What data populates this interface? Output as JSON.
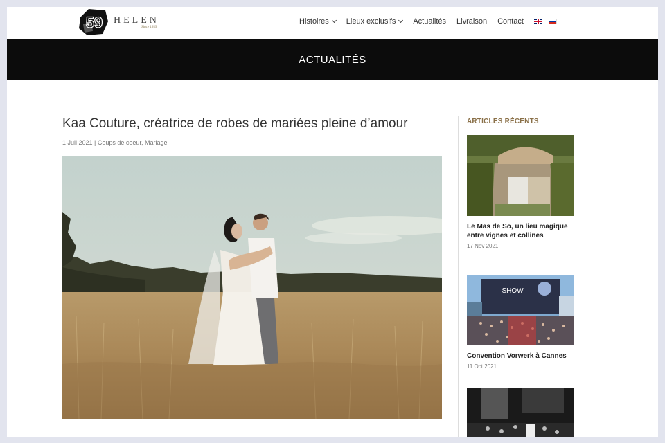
{
  "header": {
    "logo": {
      "number": "59",
      "name": "HELEN",
      "since": "Since 1959"
    },
    "nav": [
      {
        "label": "Histoires",
        "dropdown": true
      },
      {
        "label": "Lieux exclusifs",
        "dropdown": true
      },
      {
        "label": "Actualités",
        "dropdown": false
      },
      {
        "label": "Livraison",
        "dropdown": false
      },
      {
        "label": "Contact",
        "dropdown": false
      }
    ],
    "flags": [
      "english-flag-icon",
      "russian-flag-icon"
    ]
  },
  "banner": {
    "title": "ACTUALITÉS"
  },
  "article": {
    "title": "Kaa Couture, créatrice de robes de mariées pleine d’amour",
    "date": "1 Juil 2021",
    "separator": " | ",
    "category_1": "Coups de coeur",
    "category_sep": ", ",
    "category_2": "Mariage"
  },
  "sidebar": {
    "title": "ARTICLES RÉCENTS",
    "posts": [
      {
        "title": "Le Mas de So, un lieu magique entre vignes et collines",
        "date": "17 Nov 2021"
      },
      {
        "title": "Convention Vorwerk à Cannes",
        "date": "11 Oct 2021",
        "sign": "SHOW"
      },
      {
        "title": "",
        "date": ""
      }
    ]
  },
  "colors": {
    "banner_bg": "#0c0c0c",
    "accent_gold": "#8a7048",
    "page_bg": "#e2e4ee"
  }
}
